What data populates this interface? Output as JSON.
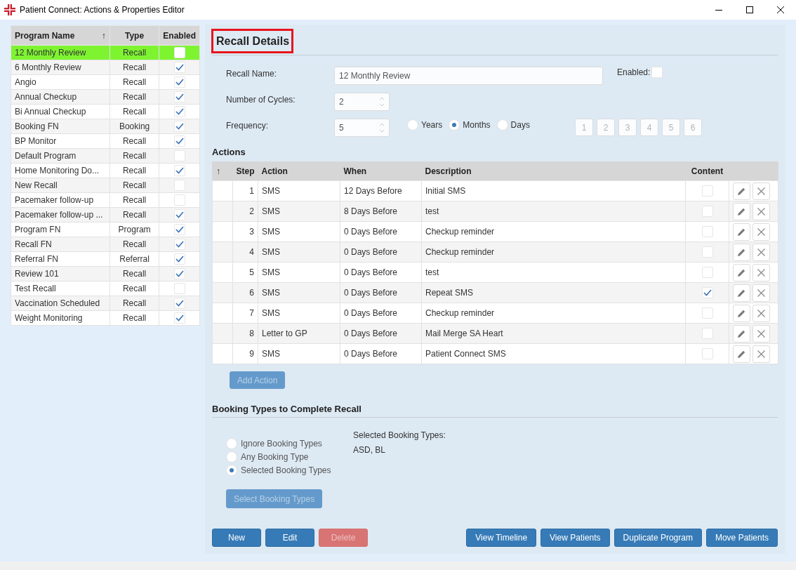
{
  "window": {
    "title": "Patient Connect: Actions & Properties Editor"
  },
  "programs": {
    "columns": [
      {
        "label": "Program Name",
        "sort_indicator": "↑"
      },
      {
        "label": "Type"
      },
      {
        "label": "Enabled"
      }
    ],
    "rows": [
      {
        "name": "12 Monthly Review",
        "type": "Recall",
        "enabled": false,
        "selected": true
      },
      {
        "name": "6 Monthly Review",
        "type": "Recall",
        "enabled": true,
        "selected": false
      },
      {
        "name": "Angio",
        "type": "Recall",
        "enabled": true,
        "selected": false
      },
      {
        "name": "Annual Checkup",
        "type": "Recall",
        "enabled": true,
        "selected": false
      },
      {
        "name": "Bi Annual Checkup",
        "type": "Recall",
        "enabled": true,
        "selected": false
      },
      {
        "name": "Booking FN",
        "type": "Booking",
        "enabled": true,
        "selected": false
      },
      {
        "name": "BP Monitor",
        "type": "Recall",
        "enabled": true,
        "selected": false
      },
      {
        "name": "Default Program",
        "type": "Recall",
        "enabled": false,
        "selected": false
      },
      {
        "name": "Home Monitoring Do...",
        "type": "Recall",
        "enabled": true,
        "selected": false
      },
      {
        "name": "New Recall",
        "type": "Recall",
        "enabled": false,
        "selected": false
      },
      {
        "name": "Pacemaker follow-up",
        "type": "Recall",
        "enabled": false,
        "selected": false
      },
      {
        "name": "Pacemaker follow-up ...",
        "type": "Recall",
        "enabled": true,
        "selected": false
      },
      {
        "name": "Program FN",
        "type": "Program",
        "enabled": true,
        "selected": false
      },
      {
        "name": "Recall FN",
        "type": "Recall",
        "enabled": true,
        "selected": false
      },
      {
        "name": "Referral FN",
        "type": "Referral",
        "enabled": true,
        "selected": false
      },
      {
        "name": "Review 101",
        "type": "Recall",
        "enabled": true,
        "selected": false
      },
      {
        "name": "Test Recall",
        "type": "Recall",
        "enabled": false,
        "selected": false
      },
      {
        "name": "Vaccination Scheduled",
        "type": "Recall",
        "enabled": true,
        "selected": false
      },
      {
        "name": "Weight Monitoring",
        "type": "Recall",
        "enabled": true,
        "selected": false
      }
    ]
  },
  "recall_details": {
    "title": "Recall Details",
    "title_highlighted": true,
    "recall_name": {
      "label": "Recall Name:",
      "value": "12 Monthly Review"
    },
    "enabled": {
      "label": "Enabled:",
      "checked": false
    },
    "cycles": {
      "label": "Number of Cycles:",
      "value": "2"
    },
    "frequency": {
      "label": "Frequency:",
      "value": "5",
      "units": [
        {
          "label": "Years",
          "selected": false
        },
        {
          "label": "Months",
          "selected": true
        },
        {
          "label": "Days",
          "selected": false
        }
      ],
      "number_buttons": [
        {
          "label": "1",
          "disabled": true
        },
        {
          "label": "2",
          "disabled": true
        },
        {
          "label": "3",
          "disabled": true
        },
        {
          "label": "4",
          "disabled": true
        },
        {
          "label": "5",
          "disabled": true
        },
        {
          "label": "6",
          "disabled": true
        }
      ]
    }
  },
  "actions": {
    "title": "Actions",
    "sort_indicator": "↑",
    "columns": [
      "Step",
      "Action",
      "When",
      "Description",
      "Content"
    ],
    "rows": [
      {
        "step": "1",
        "action": "SMS",
        "when": "12 Days Before",
        "description": "Initial SMS",
        "content": false
      },
      {
        "step": "2",
        "action": "SMS",
        "when": "8 Days Before",
        "description": "test",
        "content": false
      },
      {
        "step": "3",
        "action": "SMS",
        "when": "0 Days Before",
        "description": "Checkup reminder",
        "content": false
      },
      {
        "step": "4",
        "action": "SMS",
        "when": "0 Days Before",
        "description": "Checkup reminder",
        "content": false
      },
      {
        "step": "5",
        "action": "SMS",
        "when": "0 Days Before",
        "description": "test",
        "content": false
      },
      {
        "step": "6",
        "action": "SMS",
        "when": "0 Days Before",
        "description": "Repeat SMS",
        "content": true
      },
      {
        "step": "7",
        "action": "SMS",
        "when": "0 Days Before",
        "description": "Checkup reminder",
        "content": false
      },
      {
        "step": "8",
        "action": "Letter to GP",
        "when": "0 Days Before",
        "description": "Mail Merge SA Heart",
        "content": false
      },
      {
        "step": "9",
        "action": "SMS",
        "when": "0 Days Before",
        "description": "Patient Connect SMS",
        "content": false
      }
    ],
    "add_button": {
      "label": "Add Action",
      "disabled": true
    }
  },
  "booking": {
    "title": "Booking Types to Complete Recall",
    "options": [
      {
        "label": "Ignore Booking Types",
        "selected": false
      },
      {
        "label": "Any Booking Type",
        "selected": false
      },
      {
        "label": "Selected Booking Types",
        "selected": true
      }
    ],
    "selected_label": "Selected Booking Types:",
    "selected_value": "ASD, BL",
    "select_button": {
      "label": "Select Booking Types",
      "disabled": true
    }
  },
  "buttons": [
    {
      "label": "New",
      "kind": "primary",
      "disabled": false
    },
    {
      "label": "Edit",
      "kind": "primary",
      "disabled": false
    },
    {
      "label": "Delete",
      "kind": "danger",
      "disabled": true
    },
    {
      "label": "View Timeline",
      "kind": "primary",
      "disabled": false
    },
    {
      "label": "View Patients",
      "kind": "primary",
      "disabled": false
    },
    {
      "label": "Duplicate Program",
      "kind": "primary",
      "disabled": false
    },
    {
      "label": "Move Patients",
      "kind": "primary",
      "disabled": false
    }
  ]
}
